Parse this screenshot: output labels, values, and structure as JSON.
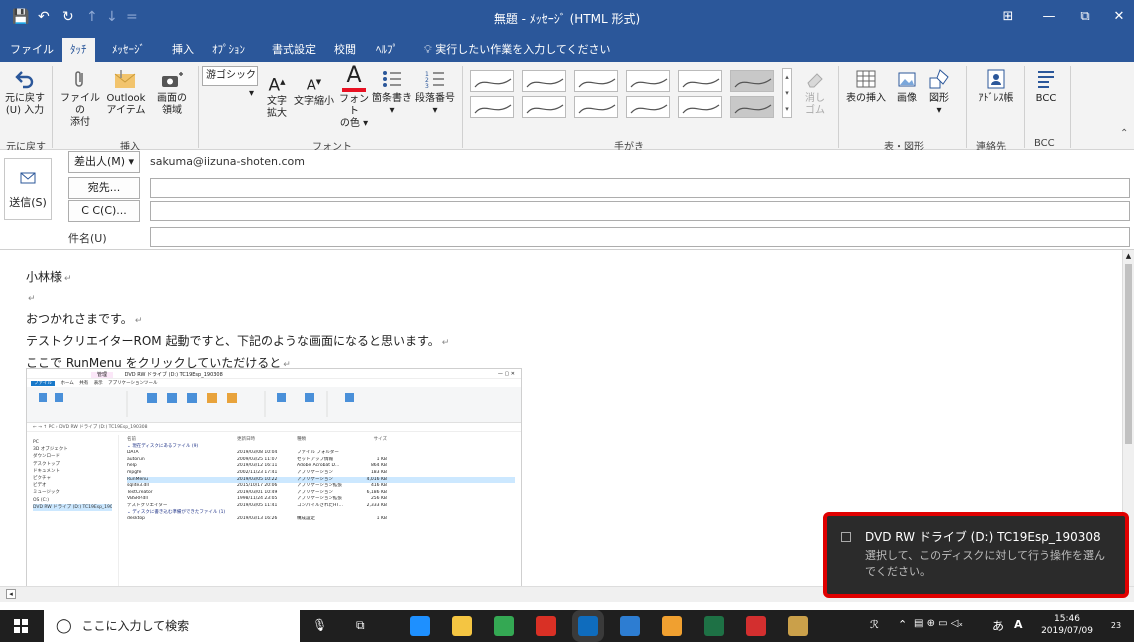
{
  "window": {
    "title": "無題 - ﾒｯｾｰｼﾞ (HTML 形式)",
    "qat": [
      "💾",
      "↶",
      "↻",
      "↑",
      "↓",
      "="
    ],
    "controls": [
      "⊞",
      "—",
      "⧉",
      "✕"
    ]
  },
  "tabs": [
    {
      "label": "ファイル",
      "active": false
    },
    {
      "label": "ﾀｯﾁ",
      "active": true
    },
    {
      "label": "ﾒｯｾｰｼﾞ",
      "active": false
    },
    {
      "label": "挿入",
      "active": false
    },
    {
      "label": "ｵﾌﾟｼｮﾝ",
      "active": false
    },
    {
      "label": "書式設定",
      "active": false
    },
    {
      "label": "校閲",
      "active": false
    },
    {
      "label": "ﾍﾙﾌﾟ",
      "active": false
    }
  ],
  "tell_me": "実行したい作業を入力してください",
  "ribbon": {
    "undo": {
      "line1": "元に戻す",
      "line2": "(U) 入力",
      "group": "元に戻す"
    },
    "include": {
      "group": "挿入",
      "attach_file": {
        "line1": "ファイルの",
        "line2": "添付"
      },
      "outlook_item": {
        "line1": "Outlook",
        "line2": "アイテム"
      },
      "screenshot": {
        "line1": "画面の",
        "line2": "領域"
      }
    },
    "font": {
      "group": "フォント",
      "font_name": "游ゴシック",
      "grow": {
        "line1": "文字",
        "line2": "拡大"
      },
      "shrink": {
        "line1": "文字縮小",
        "line2": ""
      },
      "color": {
        "line1": "フォント",
        "line2": "の色"
      },
      "bullets": {
        "line1": "箇条書き",
        "line2": ""
      },
      "numbering": {
        "line1": "段落番号",
        "line2": ""
      }
    },
    "ink": {
      "group": "手がき",
      "eraser": {
        "line1": "消し",
        "line2": "ゴム"
      }
    },
    "tables": {
      "group": "表・図形",
      "table": {
        "line1": "表の挿入",
        "line2": ""
      },
      "image": {
        "line1": "画像",
        "line2": ""
      },
      "shapes": {
        "line1": "図形",
        "line2": ""
      }
    },
    "names": {
      "group": "連絡先",
      "address_book": {
        "line1": "ｱﾄﾞﾚｽ帳",
        "line2": ""
      }
    },
    "bcc": {
      "group": "BCC",
      "bcc": {
        "line1": "BCC",
        "line2": ""
      }
    }
  },
  "header": {
    "send_label": "送信(S)",
    "from_button": "差出人(M) ▾",
    "from_value": "sakuma@iizuna-shoten.com",
    "to_button": "宛先...",
    "cc_button": "C C(C)...",
    "subject_label": "件名(U)",
    "to_value": "",
    "cc_value": "",
    "subject_value": ""
  },
  "body": {
    "lines": [
      "小林様",
      "",
      "おつかれさまです。",
      "テストクリエイターROM 起動ですと、下記のような画面になると思います。",
      "ここで RunMenu をクリックしていただけると"
    ]
  },
  "explorer": {
    "title": "DVD RW ドライブ (D:) TC19Esp_190308",
    "address": "PC › DVD RW ドライブ (D:) TC19Esp_190308",
    "tabs": [
      "ファイル",
      "ホーム",
      "共有",
      "表示",
      "アプリケーションツール"
    ],
    "nav": [
      "PC",
      "3D オブジェクト",
      "ダウンロード",
      "デスクトップ",
      "ドキュメント",
      "ピクチャ",
      "ビデオ",
      "ミュージック",
      "OS (C:)",
      "DVD RW ドライブ (D:) TC19Esp_190308"
    ],
    "columns": [
      "名前",
      "更新日時",
      "種類",
      "サイズ"
    ],
    "group1": "現在ディスクにあるファイル (9)",
    "files": [
      {
        "name": "DATA",
        "date": "2019/03/08 10:04",
        "type": "ファイル フォルダー",
        "size": ""
      },
      {
        "name": "autorun",
        "date": "2009/03/25 11:07",
        "type": "セットアップ情報",
        "size": "1 KB"
      },
      {
        "name": "help",
        "date": "2019/03/12 16:11",
        "type": "Adobe Acrobat D...",
        "size": "864 KB"
      },
      {
        "name": "mpgfe",
        "date": "2002/11/23 17:41",
        "type": "アプリケーション",
        "size": "183 KB"
      },
      {
        "name": "RunMenu",
        "date": "2019/03/05 10:22",
        "type": "アプリケーション",
        "size": "4,016 KB"
      },
      {
        "name": "sqlite3.dll",
        "date": "2015/10/17 20:06",
        "type": "アプリケーション拡張",
        "size": "416 KB"
      },
      {
        "name": "TestCreator",
        "date": "2019/03/01 10:49",
        "type": "アプリケーション",
        "size": "6,186 KB"
      },
      {
        "name": "VBSRP.dll",
        "date": "1998/11/24 23:05",
        "type": "アプリケーション拡張",
        "size": "256 KB"
      },
      {
        "name": "テストクリエイター",
        "date": "2019/03/05 11:41",
        "type": "コンパイルされたHT...",
        "size": "2,333 KB"
      }
    ],
    "group2": "ディスクに書き込む準備ができたファイル (1)",
    "pending": [
      {
        "name": "desktop",
        "date": "2019/03/13 16:26",
        "type": "構成設定",
        "size": "1 KB"
      }
    ]
  },
  "toast": {
    "title": "DVD RW ドライブ (D:) TC19Esp_190308",
    "message": "選択して、このディスクに対して行う操作を選んでください。"
  },
  "taskbar": {
    "search_placeholder": "ここに入力して検索",
    "time": "15:46",
    "date": "2019/07/09",
    "ime": "あ",
    "notification_count": "23"
  },
  "colors": {
    "accent": "#2b579a",
    "toast_border": "#e00000",
    "toast_bg": "#2b2b2b",
    "taskbar": "#1f1f1f",
    "font_color_red": "#e81123"
  }
}
